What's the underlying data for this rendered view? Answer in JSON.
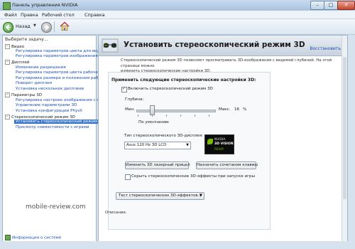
{
  "window": {
    "title": "Панель управления NVIDIA",
    "min_glyph": "–",
    "max_glyph": "□",
    "close_glyph": "✕"
  },
  "menu": [
    "Файл",
    "Правка",
    "Рабочий стол",
    "Справка"
  ],
  "toolbar": {
    "back_label": "Назад",
    "dropdown_glyph": "▼",
    "home_icon": "home-icon"
  },
  "left_panel": {
    "header": "Выберите задачу...",
    "items": [
      {
        "label": "Видео",
        "expander": "−"
      },
      {
        "label": "Регулировка параметров цвета для вид"
      },
      {
        "label": "Регулировка параметров изображения д"
      },
      {
        "label": "Дисплей",
        "expander": "−"
      },
      {
        "label": "Изменение разрешения"
      },
      {
        "label": "Регулировка параметров цвета рабочег"
      },
      {
        "label": "Регулировка размера и положения рабо"
      },
      {
        "label": "Поворот дисплея"
      },
      {
        "label": "Установка нескольких дисплеев"
      },
      {
        "label": "Параметры 3D",
        "expander": "−"
      },
      {
        "label": "Регулировка настроек изображения с пр"
      },
      {
        "label": "Управление параметрами 3D"
      },
      {
        "label": "Установка конфигурации PhysX"
      },
      {
        "label": "Стереоскопический режим 3D",
        "expander": "−"
      },
      {
        "label": "Установить стереоскопический режим 3D"
      },
      {
        "label": "Просмотр совместимости с играми"
      }
    ],
    "watermark": "mobile-review.com",
    "info_link": "Информация о системе"
  },
  "main": {
    "title": "Установить стереоскопический режим 3D",
    "restore": "Восстановить",
    "description_line1": "Стереоскопический режим 3D позволяет просматривать 3D-изображения с видимой глубиной. На этой странице можно",
    "description_line2": "изменить стереоскопические настройки 3D.",
    "section_title": "Применить следующие стереоскопические настройки 3D:",
    "enable_label": "Включить стереоскопический режим 3D",
    "enable_checked": true,
    "depth_label": "Глубина:",
    "depth_min": "Мин.",
    "depth_max": "Макс.",
    "depth_value": "16",
    "depth_unit": "%",
    "depth_default": "По умолчанию",
    "display_type_label": "Тип стереоскопического 3D-дисплея:",
    "display_type_value": "Asus 120 Hz 3D LCD",
    "select_arrow": "▼",
    "logo": {
      "line1": "NVIDIA.",
      "line2": "3D VISION",
      "line3": "READY"
    },
    "btn_laser": "Изменить 3D лазерный прицел",
    "btn_hotkeys": "Назначить сочетания клавиш",
    "hide_effects_label": "Скрыть стереоскопические 3D-эффекты при запуске игры",
    "hide_effects_checked": false,
    "btn_test": "Тест стереоскопических 3D-эффектов...",
    "btn_test_arrow": "▼",
    "desc_footer": "Описание."
  },
  "colors": {
    "accent": "#3a74c9",
    "link": "#1c4fb4",
    "nvidia_green": "#76b900"
  }
}
